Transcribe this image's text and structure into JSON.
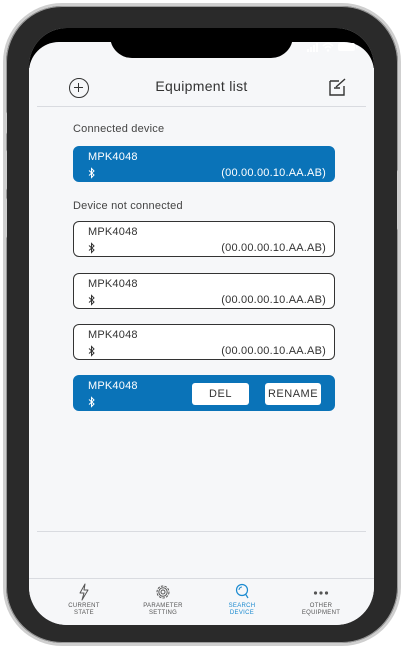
{
  "header": {
    "title": "Equipment list"
  },
  "sections": {
    "connected_label": "Connected device",
    "not_connected_label": "Device not connected"
  },
  "connected_device": {
    "name": "MPK4048",
    "address": "(00.00.00.10.AA.AB)"
  },
  "devices": [
    {
      "name": "MPK4048",
      "address": "(00.00.00.10.AA.AB)"
    },
    {
      "name": "MPK4048",
      "address": "(00.00.00.10.AA.AB)"
    },
    {
      "name": "MPK4048",
      "address": "(00.00.00.10.AA.AB)"
    }
  ],
  "selected_device": {
    "name": "MPK4048",
    "del_label": "DEL",
    "rename_label": "RENAME"
  },
  "tabs": [
    {
      "label": "CURRENT\nSTATE",
      "icon": "bolt-icon"
    },
    {
      "label": "PARAMETER\nSETTING",
      "icon": "gear-icon"
    },
    {
      "label": "SEARCH\nDEVICE",
      "icon": "search-icon"
    },
    {
      "label": "OTHER\nEQUIPMENT",
      "icon": "more-icon"
    }
  ],
  "colors": {
    "accent": "#0a73b8",
    "active_tab": "#1a8ad0",
    "background": "#f6f7f9"
  }
}
